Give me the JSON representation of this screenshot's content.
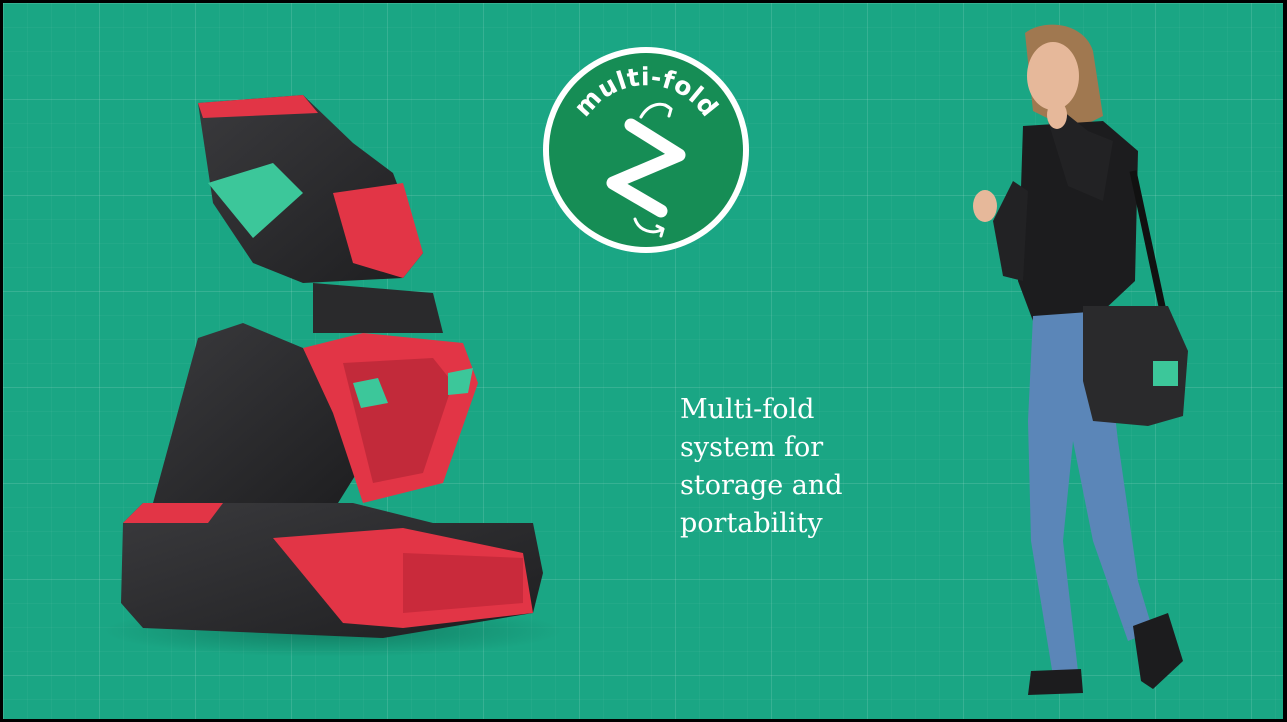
{
  "badge": {
    "label": "multi-fold",
    "icon": "zigzag-fold-arrows-icon"
  },
  "caption": {
    "lines": [
      "Multi-fold",
      "system for",
      "storage and",
      "portability"
    ]
  },
  "colors": {
    "background": "#1aa684",
    "badge_fill": "#168d55",
    "seat_red": "#e23546",
    "seat_black": "#2a2a2c",
    "accent_mint": "#3cc79a"
  },
  "images": {
    "seat": "folded-booster-seat-illustration",
    "person": "woman-carrying-folded-seat-photo"
  }
}
